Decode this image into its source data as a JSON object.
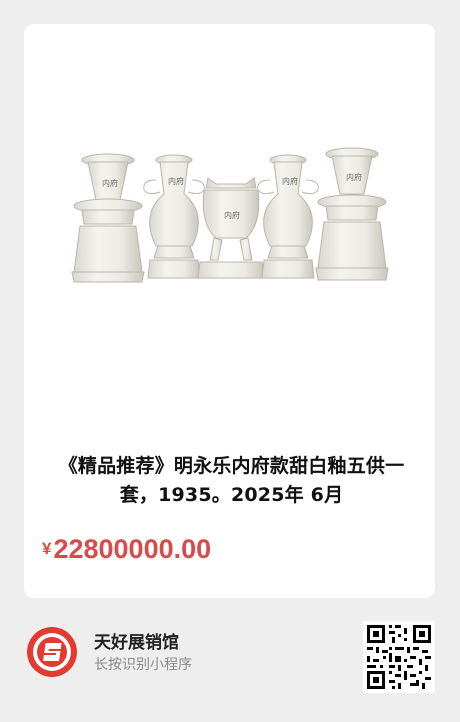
{
  "product": {
    "image_alt": "",
    "title": "《精品推荐》明永乐内府款甜白釉五供一套，1935。2025年 6月",
    "currency_symbol": "¥",
    "price": "22800000.00"
  },
  "footer": {
    "shop_name": "天好展销馆",
    "hint": "长按识别小程序"
  },
  "colors": {
    "price": "#d64b4b",
    "background": "#eeeeee",
    "card": "#ffffff",
    "logo_red": "#e23b2f"
  },
  "icons": {
    "logo": "shop-logo-icon",
    "qr": "qr-code-icon"
  }
}
